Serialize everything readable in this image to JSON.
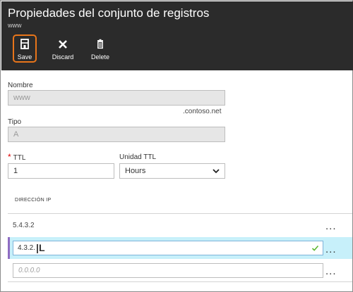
{
  "header": {
    "title": "Propiedades del conjunto de registros",
    "subtitle": "www",
    "background": "#2b2b2b"
  },
  "toolbar": {
    "save_label": "Save",
    "discard_label": "Discard",
    "delete_label": "Delete",
    "save_icon": "save-icon",
    "discard_icon": "close-icon",
    "delete_icon": "trash-icon",
    "focus_color": "#e8751a"
  },
  "form": {
    "name_label": "Nombre",
    "name_value": "www",
    "name_suffix": ".contoso.net",
    "type_label": "Tipo",
    "type_value": "A",
    "ttl_required": "*",
    "ttl_label": "TTL",
    "ttl_value": "1",
    "ttl_unit_label": "Unidad TTL",
    "ttl_unit_value": "Hours"
  },
  "ip_table": {
    "header": "DIRECCIÓN IP",
    "rows": [
      {
        "value": "5.4.3.2",
        "menu": "..."
      }
    ],
    "editing": {
      "value": "4.3.2.",
      "cursor": "|L",
      "menu": "...",
      "highlight": "#c7f0fa"
    },
    "new_entry": {
      "placeholder": "0.0.0.0",
      "menu": "..."
    }
  }
}
